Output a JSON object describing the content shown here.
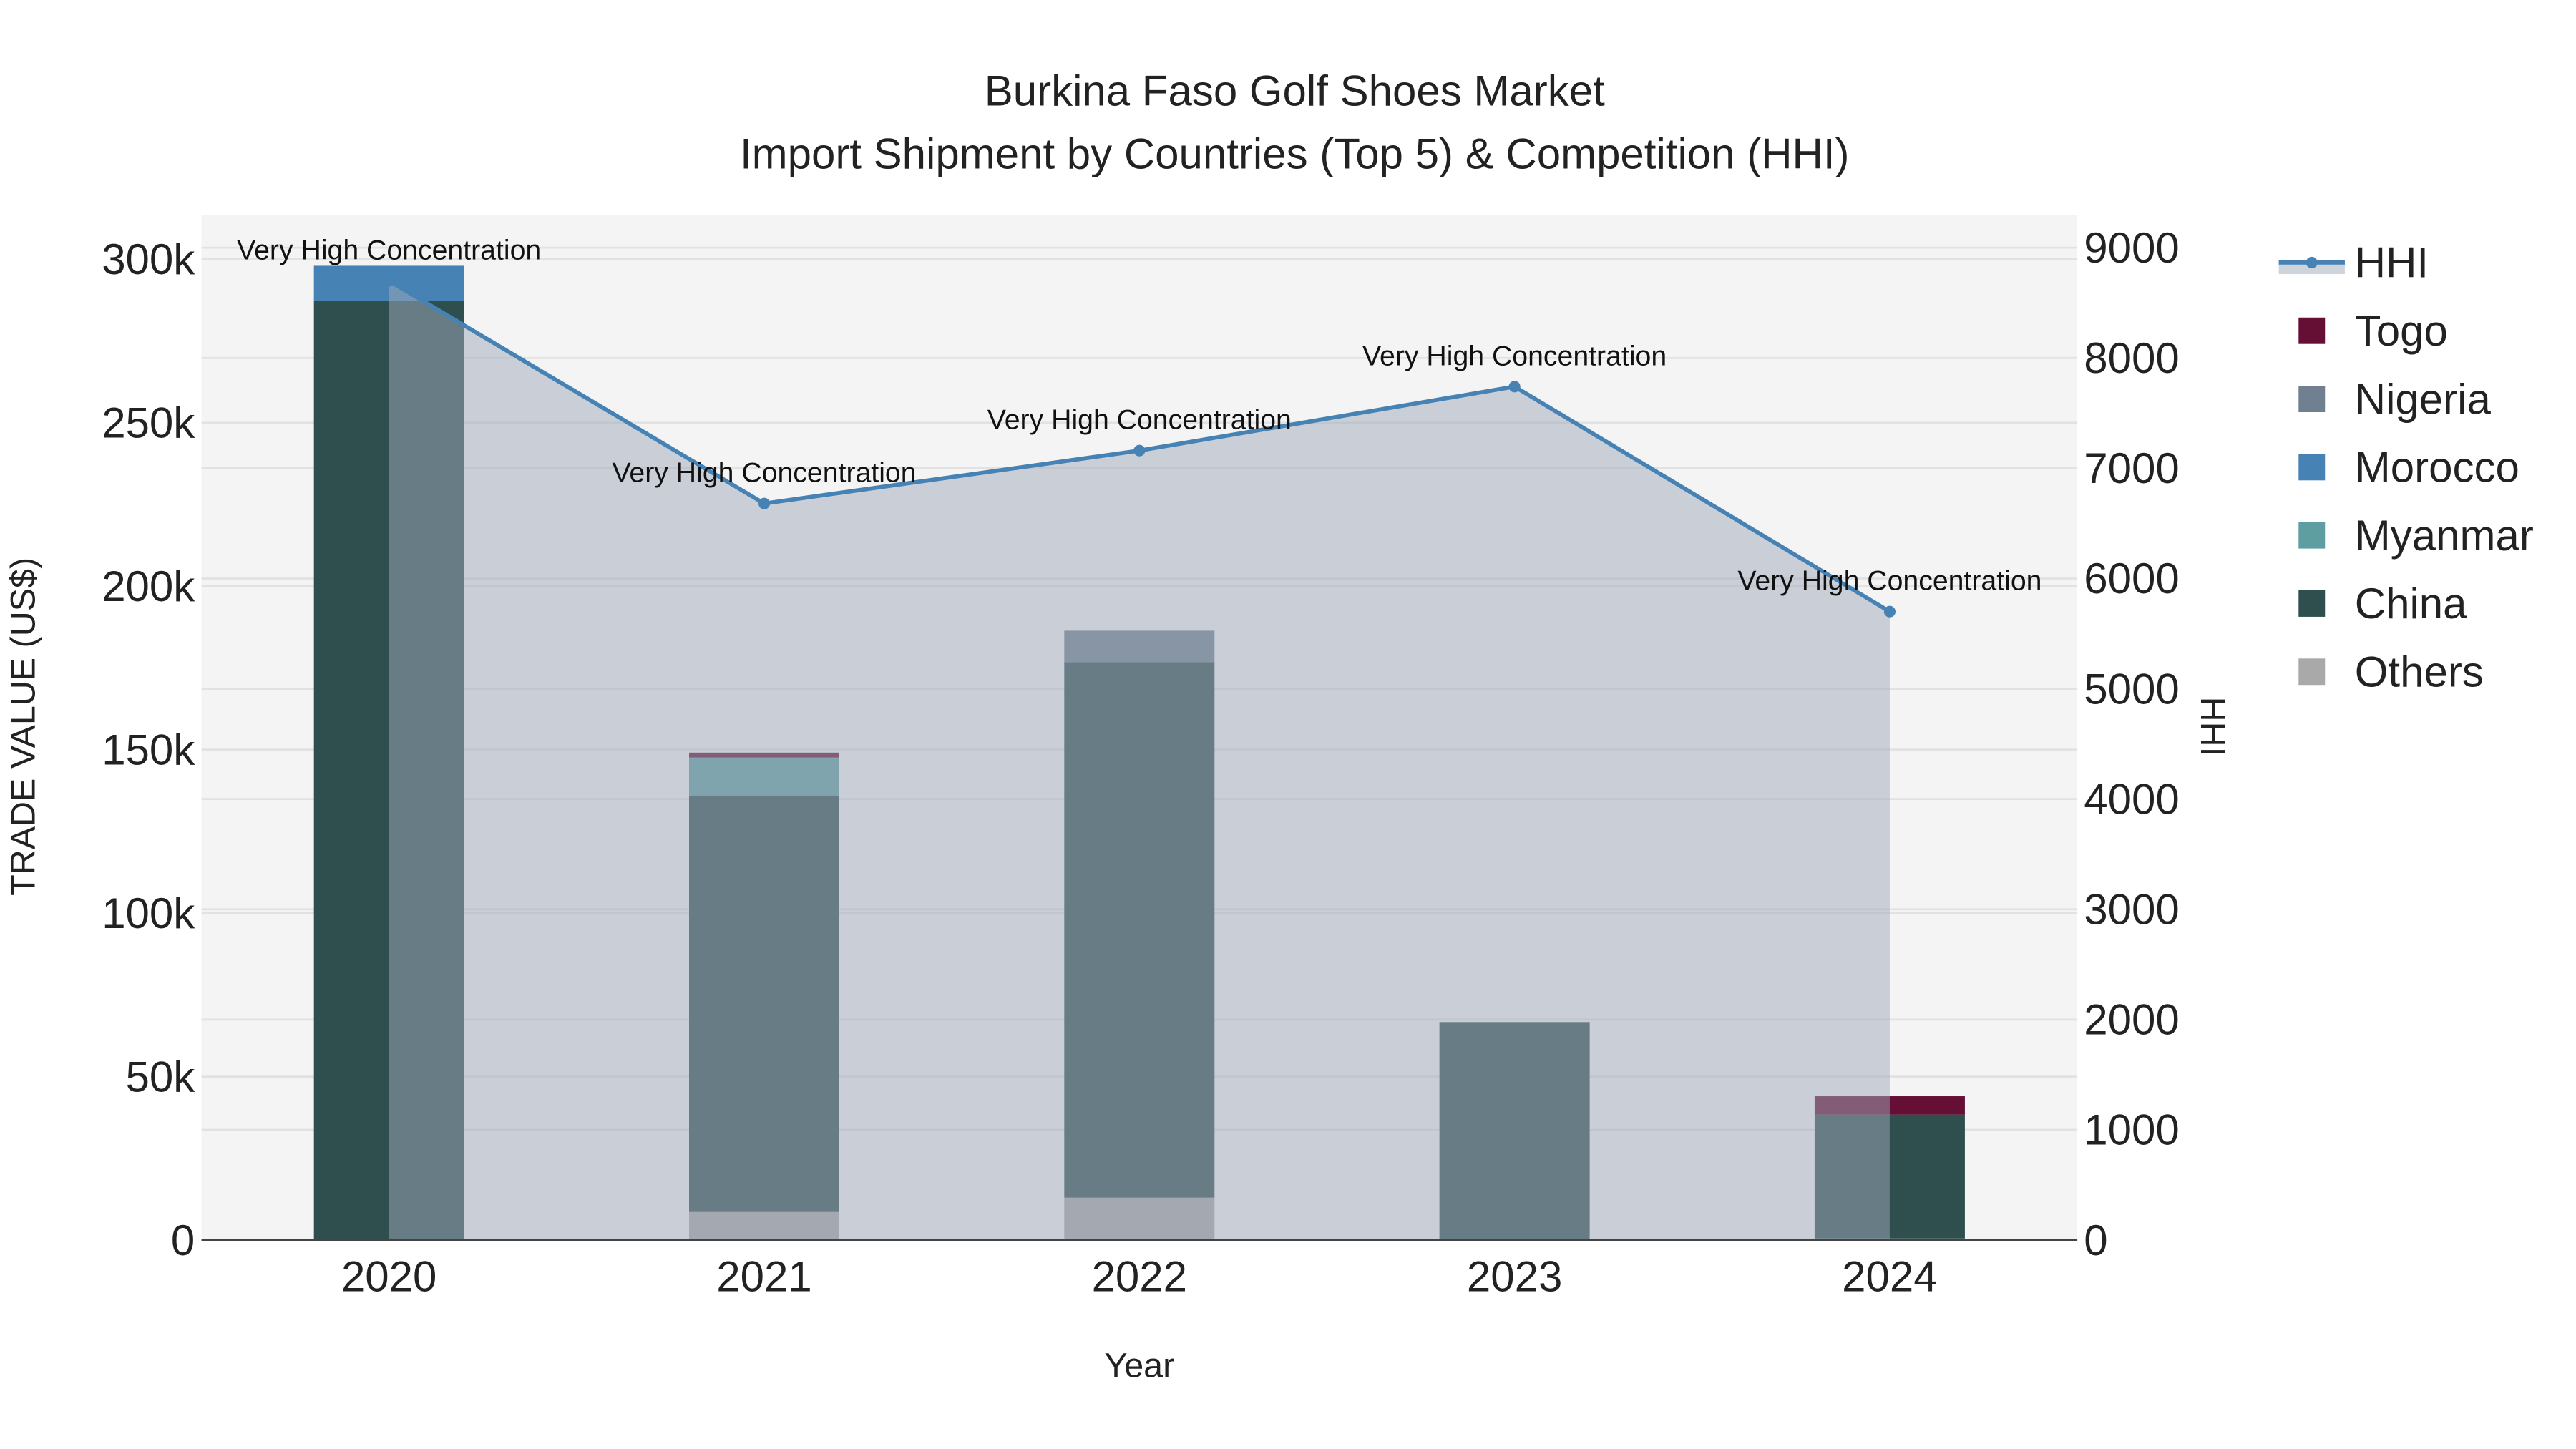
{
  "chart_data": {
    "type": "bar",
    "title": "Burkina Faso Golf Shoes Market",
    "subtitle": "Import Shipment by Countries (Top 5) & Competition (HHI)",
    "xlabel": "Year",
    "ylabel": "TRADE VALUE (US$)",
    "y2label": "HHI",
    "categories": [
      "2020",
      "2021",
      "2022",
      "2023",
      "2024"
    ],
    "ylim": [
      0,
      310000
    ],
    "y2lim": [
      0,
      9300
    ],
    "yticks": [
      0,
      50000,
      100000,
      150000,
      200000,
      250000,
      300000
    ],
    "ytick_labels": [
      "0",
      "50k",
      "100k",
      "150k",
      "200k",
      "250k",
      "300k"
    ],
    "y2ticks": [
      0,
      1000,
      2000,
      3000,
      4000,
      5000,
      6000,
      7000,
      8000,
      9000
    ],
    "y2tick_labels": [
      "0",
      "1000",
      "2000",
      "3000",
      "4000",
      "5000",
      "6000",
      "7000",
      "8000",
      "9000"
    ],
    "grid": true,
    "legend_position": "right",
    "series": [
      {
        "name": "Others",
        "color": "#a9a9a9",
        "values": [
          300,
          8600,
          13000,
          0,
          500
        ]
      },
      {
        "name": "China",
        "color": "#2f4f4f",
        "values": [
          287000,
          127400,
          163800,
          66700,
          37900
        ]
      },
      {
        "name": "Myanmar",
        "color": "#5f9ea0",
        "values": [
          0,
          11600,
          0,
          0,
          0
        ]
      },
      {
        "name": "Morocco",
        "color": "#4682b4",
        "values": [
          10700,
          0,
          0,
          0,
          0
        ]
      },
      {
        "name": "Nigeria",
        "color": "#708090",
        "values": [
          0,
          0,
          9600,
          0,
          0
        ]
      },
      {
        "name": "Togo",
        "color": "#660f35",
        "values": [
          0,
          1500,
          0,
          0,
          5600
        ]
      }
    ],
    "hhi": {
      "name": "HHI",
      "color": "#4682b4",
      "values": [
        8700,
        6680,
        7160,
        7740,
        5700
      ],
      "annotations": [
        "Very High Concentration",
        "Very High Concentration",
        "Very High Concentration",
        "Very High Concentration",
        "Very High Concentration"
      ]
    },
    "legend_order": [
      "HHI",
      "Togo",
      "Nigeria",
      "Morocco",
      "Myanmar",
      "China",
      "Others"
    ]
  }
}
